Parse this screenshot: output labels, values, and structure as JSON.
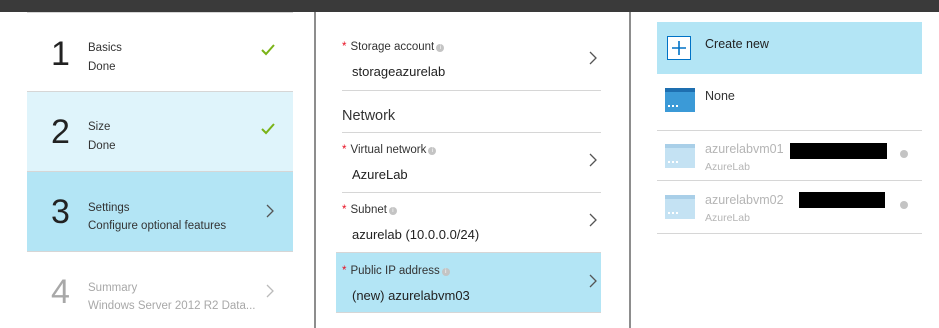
{
  "steps": [
    {
      "number": "1",
      "title": "Basics",
      "subtitle": "Done",
      "status": "done"
    },
    {
      "number": "2",
      "title": "Size",
      "subtitle": "Done",
      "status": "done"
    },
    {
      "number": "3",
      "title": "Settings",
      "subtitle": "Configure optional features",
      "status": "active"
    },
    {
      "number": "4",
      "title": "Summary",
      "subtitle": "Windows Server 2012 R2 Data...",
      "status": "pending"
    }
  ],
  "settings": {
    "storage": {
      "label": "Storage account",
      "value": "storageazurelab"
    },
    "network_heading": "Network",
    "vnet": {
      "label": "Virtual network",
      "value": "AzureLab"
    },
    "subnet": {
      "label": "Subnet",
      "value": "azurelab (10.0.0.0/24)"
    },
    "public_ip": {
      "label": "Public IP address",
      "value": "(new) azurelabvm03"
    }
  },
  "list": {
    "create_new": "Create new",
    "none": "None",
    "items": [
      {
        "name": "azurelabvm01",
        "group": "AzureLab"
      },
      {
        "name": "azurelabvm02",
        "group": "AzureLab"
      }
    ]
  },
  "colors": {
    "selected": "#b3e5f5",
    "light_selected": "#dff4fb",
    "check_green": "#7ab317",
    "required_red": "#e81123",
    "accent_blue": "#0072c6"
  }
}
